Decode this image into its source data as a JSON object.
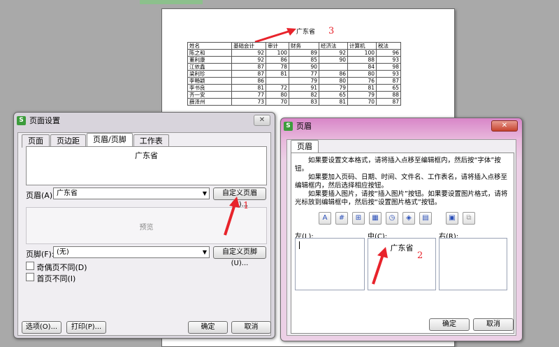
{
  "preview": {
    "header_text": "广东省",
    "table": {
      "headers": [
        "姓名",
        "基础会计",
        "审计",
        "财务",
        "经济法",
        "计算机",
        "税法"
      ],
      "rows": [
        [
          "陈之和",
          "92",
          "100",
          "89",
          "92",
          "100",
          "96"
        ],
        [
          "董利康",
          "92",
          "86",
          "85",
          "90",
          "88",
          "93"
        ],
        [
          "江依鑫",
          "87",
          "78",
          "90",
          "",
          "84",
          "98"
        ],
        [
          "梁利珍",
          "87",
          "81",
          "77",
          "86",
          "80",
          "93"
        ],
        [
          "李畅颖",
          "86",
          "",
          "79",
          "80",
          "76",
          "87"
        ],
        [
          "李书良",
          "81",
          "72",
          "91",
          "79",
          "81",
          "65"
        ],
        [
          "齐一安",
          "77",
          "80",
          "82",
          "65",
          "79",
          "88"
        ],
        [
          "薛泽州",
          "73",
          "70",
          "83",
          "81",
          "70",
          "87"
        ]
      ]
    }
  },
  "annotations": [
    "1",
    "2",
    "3"
  ],
  "colors": {
    "annotation": "#e8232b",
    "brand_icon": "#3c9c3c"
  },
  "page_setup": {
    "title": "页面设置",
    "close": "✕",
    "icon_letter": "S",
    "tabs": [
      "页面",
      "页边距",
      "页眉/页脚",
      "工作表"
    ],
    "header_preview": "广东省",
    "header_label": "页眉(A):",
    "header_value": "广东省",
    "custom_header": "自定义页眉(C)...",
    "footer_preview": "预览",
    "footer_label": "页脚(F):",
    "footer_value": "(无)",
    "custom_footer": "自定义页脚(U)...",
    "odd_even": "奇偶页不同(D)",
    "first_page": "首页不同(I)",
    "options": "选项(O)...",
    "print": "打印(P)...",
    "ok": "确定",
    "cancel": "取消"
  },
  "header_dialog": {
    "title": "页眉",
    "close": "✕",
    "icon_letter": "S",
    "tab": "页眉",
    "instructions": [
      "如果要设置文本格式，请将插入点移至编辑框内，然后按“字体”按钮。",
      "如果要加入页码、日期、时间、文件名、工作表名，请将插入点移至编辑框内，然后选择相应按钮。",
      "如果要插入图片，请按“插入图片”按钮。如果要设置图片格式，请将光标放到编辑框中，然后按“设置图片格式”按钮。"
    ],
    "left_label": "左(L):",
    "center_label": "中(C):",
    "right_label": "右(R):",
    "center_value": "广东省",
    "ok": "确定",
    "cancel": "取消"
  }
}
